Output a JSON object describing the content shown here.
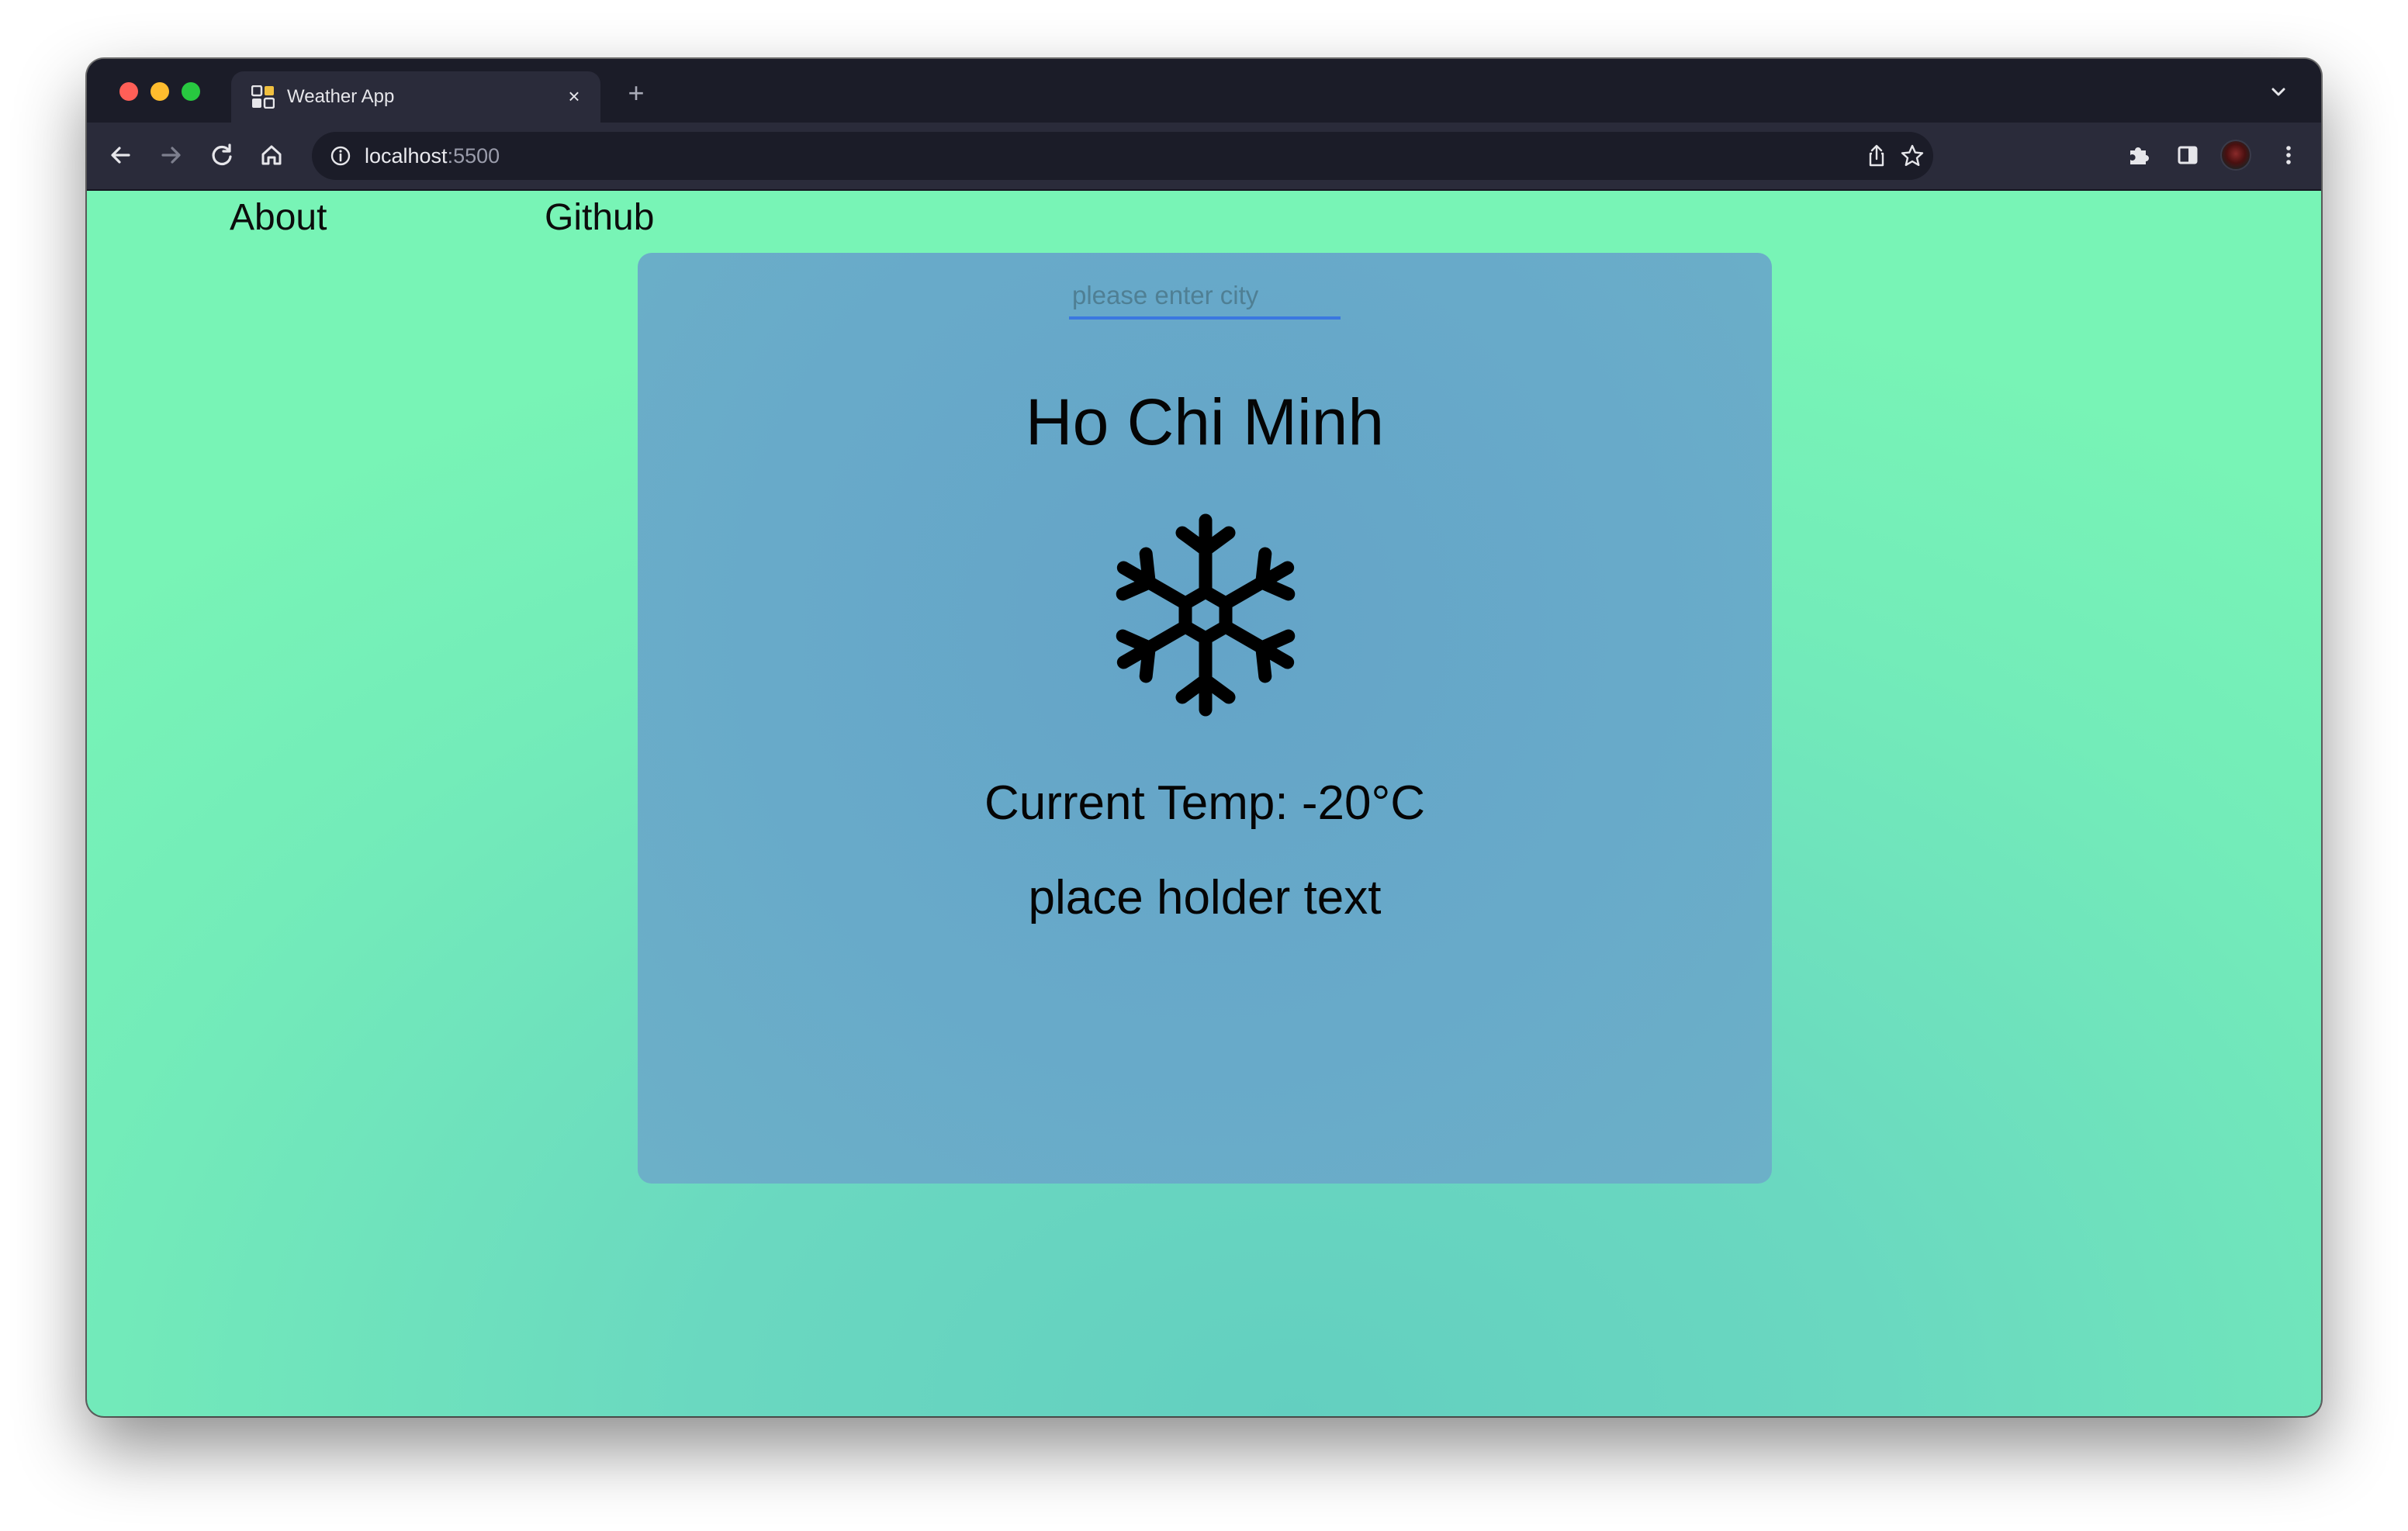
{
  "browser": {
    "tab": {
      "title": "Weather App",
      "close_glyph": "×",
      "favicon": "grid-favicon-icon"
    },
    "new_tab_glyph": "+",
    "address": {
      "host": "localhost",
      "port": ":5500"
    },
    "toolbar_icons": [
      "back-arrow-icon",
      "forward-arrow-icon",
      "reload-icon",
      "home-icon",
      "info-icon",
      "share-icon",
      "star-icon",
      "puzzle-icon",
      "side-panel-icon",
      "avatar",
      "kebab-menu-icon"
    ]
  },
  "nav": {
    "about": "About",
    "github": "Github"
  },
  "weather": {
    "search_placeholder": "please enter city",
    "search_value": "",
    "city": "Ho Chi Minh",
    "icon": "snowflake-icon",
    "temperature": "Current Temp: -20°C",
    "description": "place holder text"
  },
  "colors": {
    "page_gradient_outer": "#78f4b6",
    "page_gradient_center": "#63cfc0",
    "card": "#68aac9",
    "input_underline": "#3a78e0",
    "browser_chrome": "#1b1c28"
  }
}
